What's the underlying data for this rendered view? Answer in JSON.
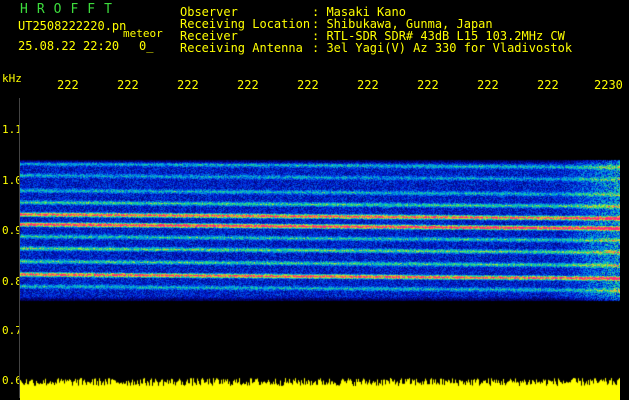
{
  "header": {
    "station": "HROFFT",
    "filename": "UT2508222220.pn",
    "mode": "meteor",
    "datetime": "25.08.22 22:20",
    "counter": "0_"
  },
  "info": [
    {
      "label": "Observer",
      "value": ": Masaki Kano"
    },
    {
      "label": "Receiving Location",
      "value": ": Shibukawa, Gunma, Japan"
    },
    {
      "label": "Receiver",
      "value": ": RTL-SDR SDR# 43dB L15 103.2MHz CW"
    },
    {
      "label": "Receiving Antenna",
      "value": ": 3el Yagi(V) Az 330 for Vladivostok"
    }
  ],
  "axes": {
    "y_unit": "kHz",
    "y_ticks": [
      "1.1",
      "1.0",
      "0.9",
      "0.8",
      "0.7",
      "0.6"
    ],
    "x_ticks": [
      "222",
      "222",
      "222",
      "222",
      "222",
      "222",
      "222",
      "222",
      "222",
      "2230"
    ]
  },
  "colors": {
    "text": "#ffff00",
    "station": "#3cdc3c",
    "background": "#000000",
    "noise_bar": "#ffff00"
  }
}
